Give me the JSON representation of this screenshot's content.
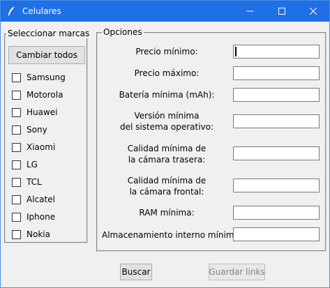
{
  "window": {
    "title": "Celulares"
  },
  "brands": {
    "legend": "Seleccionar marcas",
    "toggle_all_label": "Cambiar todos",
    "items": [
      {
        "label": "Samsung",
        "checked": false
      },
      {
        "label": "Motorola",
        "checked": false
      },
      {
        "label": "Huawei",
        "checked": false
      },
      {
        "label": "Sony",
        "checked": false
      },
      {
        "label": "Xiaomi",
        "checked": false
      },
      {
        "label": "LG",
        "checked": false
      },
      {
        "label": "TCL",
        "checked": false
      },
      {
        "label": "Alcatel",
        "checked": false
      },
      {
        "label": "Iphone",
        "checked": false
      },
      {
        "label": "Nokia",
        "checked": false
      }
    ]
  },
  "options": {
    "legend": "Opciones",
    "fields": [
      {
        "label_lines": [
          "Precio mínimo:"
        ],
        "value": ""
      },
      {
        "label_lines": [
          "Precio máximo:"
        ],
        "value": ""
      },
      {
        "label_lines": [
          "Batería mínima (mAh):"
        ],
        "value": ""
      },
      {
        "label_lines": [
          "Versión mínima",
          "del sistema operativo:"
        ],
        "value": ""
      },
      {
        "label_lines": [
          "Calidad mínima de",
          "la cámara trasera:"
        ],
        "value": ""
      },
      {
        "label_lines": [
          "Calidad mínima de",
          "la cámara frontal:"
        ],
        "value": ""
      },
      {
        "label_lines": [
          "RAM mínima:"
        ],
        "value": ""
      },
      {
        "label_lines": [
          "Almacenamiento interno mínimo:"
        ],
        "value": ""
      }
    ]
  },
  "actions": {
    "search_label": "Buscar",
    "save_links_label": "Guardar links",
    "save_links_enabled": false
  }
}
